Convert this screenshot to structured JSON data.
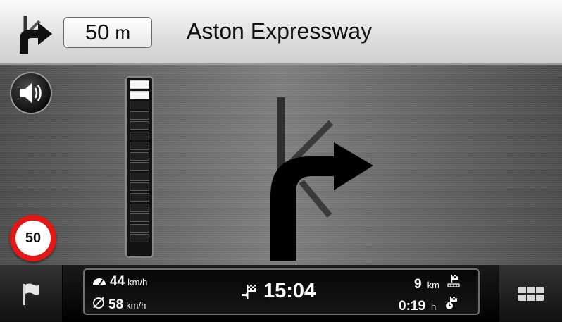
{
  "instruction": {
    "distance_value": "50",
    "distance_unit": "m",
    "street_name": "Aston Expressway",
    "maneuver_icon": "turn-right-arrow-icon"
  },
  "main": {
    "speaker_icon": "speaker-icon",
    "speed_limit": "50",
    "distance_meter": {
      "total_segments": 16,
      "lit_segments": 2
    },
    "maneuver_icon": "turn-right-arrow-icon"
  },
  "bottom": {
    "current_speed_value": "44",
    "current_speed_unit": "km/h",
    "average_speed_value": "58",
    "average_speed_unit": "km/h",
    "arrival_time": "15:04",
    "remaining_distance_value": "9",
    "remaining_distance_unit": "km",
    "remaining_time_value": "0:19",
    "remaining_time_unit": "h",
    "flag_icon": "flag-icon",
    "menu_icon": "menu-grid-icon"
  },
  "colors": {
    "speed_sign_ring": "#e01818",
    "meter_lit": "#f4f4f4",
    "arrow": "#000000"
  }
}
